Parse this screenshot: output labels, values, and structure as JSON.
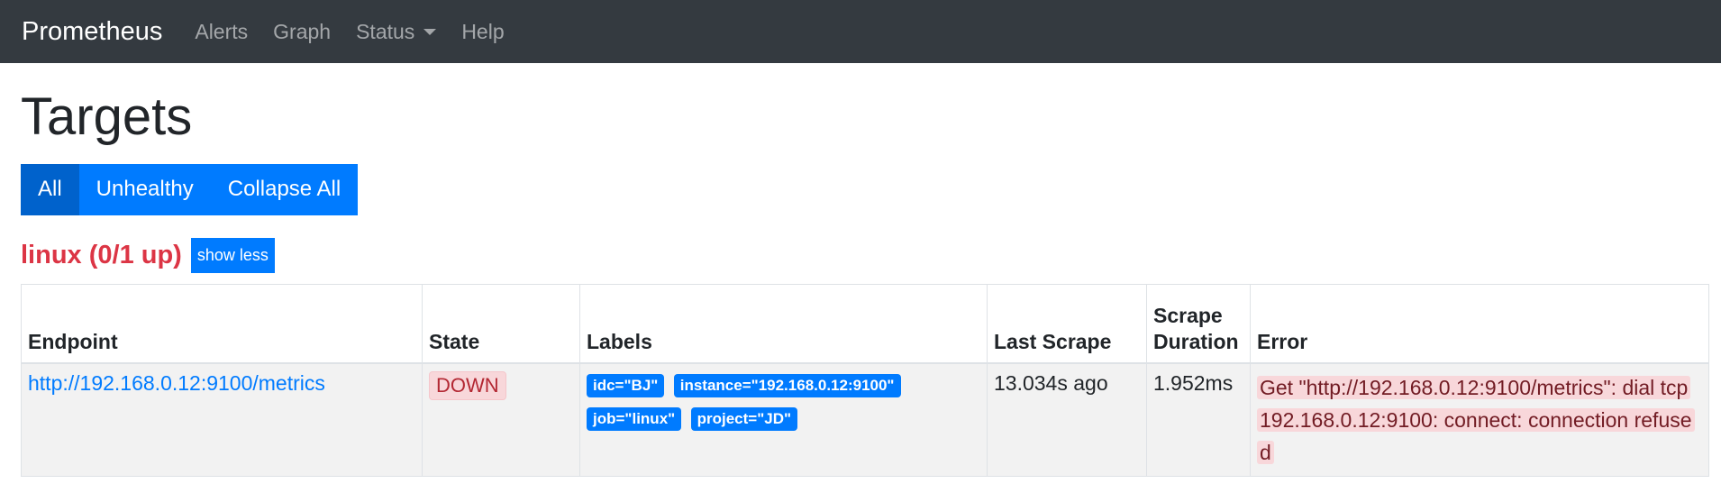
{
  "navbar": {
    "brand": "Prometheus",
    "items": [
      "Alerts",
      "Graph",
      "Status",
      "Help"
    ]
  },
  "page_title": "Targets",
  "filters": {
    "all": "All",
    "unhealthy": "Unhealthy",
    "collapse": "Collapse All"
  },
  "job": {
    "title": "linux (0/1 up)",
    "toggle_label": "show less"
  },
  "table": {
    "headers": {
      "endpoint": "Endpoint",
      "state": "State",
      "labels": "Labels",
      "last_scrape": "Last Scrape",
      "scrape_duration": "Scrape Duration",
      "error": "Error"
    },
    "rows": [
      {
        "endpoint": "http://192.168.0.12:9100/metrics",
        "state": "DOWN",
        "labels": [
          "idc=\"BJ\"",
          "instance=\"192.168.0.12:9100\"",
          "job=\"linux\"",
          "project=\"JD\""
        ],
        "last_scrape": "13.034s ago",
        "scrape_duration": "1.952ms",
        "error": "Get \"http://192.168.0.12:9100/metrics\": dial tcp 192.168.0.12:9100: connect: connection refused"
      }
    ]
  },
  "colors": {
    "navbar": "#343a40",
    "primary": "#007bff",
    "danger": "#dc3545"
  }
}
